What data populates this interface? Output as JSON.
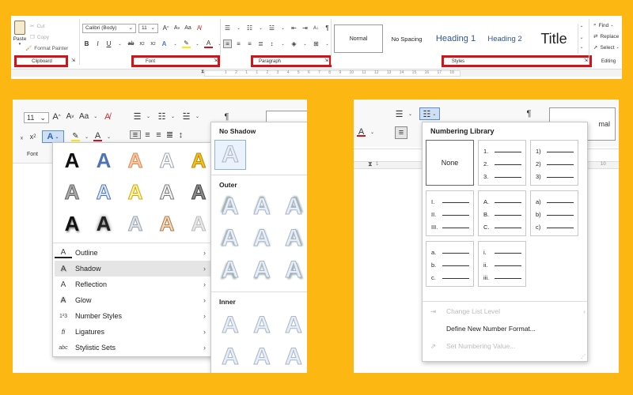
{
  "ribbon": {
    "clipboard": {
      "paste": "Paste",
      "cut": "Cut",
      "copy": "Copy",
      "format_painter": "Format Painter",
      "label": "Clipboard"
    },
    "font": {
      "name": "Calibri (Body)",
      "size": "11",
      "label": "Font"
    },
    "paragraph": {
      "label": "Paragraph"
    },
    "styles": {
      "items": [
        {
          "name": "Normal"
        },
        {
          "name": "No Spacing"
        },
        {
          "name": "Heading 1"
        },
        {
          "name": "Heading 2"
        },
        {
          "name": "Title"
        }
      ],
      "label": "Styles"
    },
    "editing": {
      "find": "Find",
      "replace": "Replace",
      "select": "Select",
      "label": "Editing"
    },
    "ruler_ticks": [
      "1",
      "2",
      "1",
      "1",
      "2",
      "3",
      "4",
      "5",
      "6",
      "7",
      "8",
      "9",
      "10",
      "11",
      "12",
      "13",
      "14",
      "15",
      "16",
      "17",
      "18"
    ]
  },
  "left_panel": {
    "font_size": "11",
    "font_group_label": "Font",
    "menu": [
      {
        "label": "Outline",
        "icon": "outline-icon"
      },
      {
        "label": "Shadow",
        "icon": "shadow-icon"
      },
      {
        "label": "Reflection",
        "icon": "reflection-icon"
      },
      {
        "label": "Glow",
        "icon": "glow-icon"
      },
      {
        "label": "Number Styles",
        "icon": "number-styles-icon",
        "icon_text": "1²3"
      },
      {
        "label": "Ligatures",
        "icon": "ligatures-icon",
        "icon_text": "fi"
      },
      {
        "label": "Stylistic Sets",
        "icon": "stylistic-sets-icon",
        "icon_text": "abc"
      }
    ],
    "shadow_submenu": {
      "no_shadow": "No Shadow",
      "outer": "Outer",
      "inner": "Inner"
    },
    "ruler_ticks": [
      "10"
    ],
    "glyph": "A"
  },
  "right_panel": {
    "title": "Numbering Library",
    "none_label": "None",
    "formats": [
      [
        "1.",
        "2.",
        "3."
      ],
      [
        "1)",
        "2)",
        "3)"
      ],
      [
        "I.",
        "II.",
        "III."
      ],
      [
        "A.",
        "B.",
        "C."
      ],
      [
        "a)",
        "b)",
        "c)"
      ],
      [
        "a.",
        "b.",
        "c."
      ],
      [
        "i.",
        "ii.",
        "iii."
      ]
    ],
    "change_list_level": "Change List Level",
    "define_new": "Define New Number Format...",
    "set_value": "Set Numbering Value...",
    "ruler_ticks": [
      "1",
      "10"
    ],
    "normal_card": "mal"
  }
}
